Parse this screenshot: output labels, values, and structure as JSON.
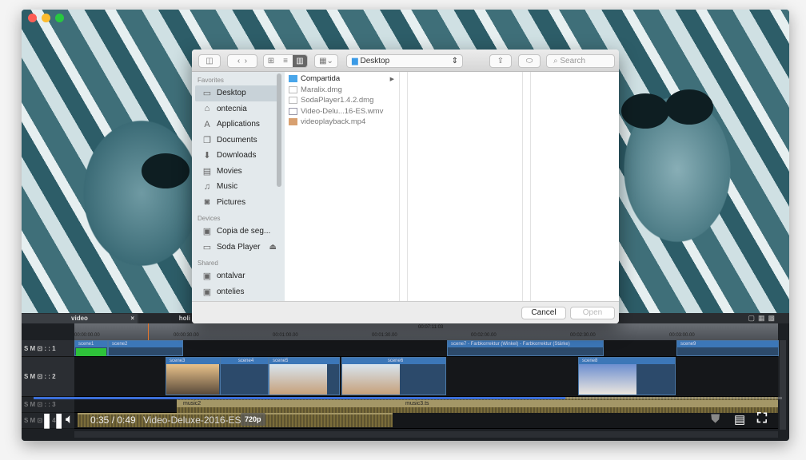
{
  "window": {
    "traffic_lights": {
      "close": "#fc5f57",
      "minimize": "#fdbc2e",
      "zoom": "#28c840"
    }
  },
  "timeline": {
    "tabs": [
      "video",
      "holi"
    ],
    "tab_close": "×",
    "ruler_center": "00:07:11:03",
    "ruler_labels": [
      "00:00:00.00",
      "00:00:30.00",
      "00:01:00.00",
      "00:01:30.00",
      "00:02:00.00",
      "00:02:30.00",
      "00:03:00.00"
    ],
    "tracks": [
      {
        "label": "S M ⊡ : : 1"
      },
      {
        "label": "S M ⊡ : : 2"
      },
      {
        "label": "S M ⊡ : : 3"
      },
      {
        "label": "S M ⊡ : : 4"
      }
    ],
    "clips": {
      "scene1": "scene1",
      "scene2": "scene2",
      "scene3": "scene3",
      "scene4": "scene4",
      "scene5": "scene5",
      "scene6": "scene6",
      "scene7": "scene7 - Farbkorrektur (Winkel) - Farbkorrektur (Stärke)",
      "scene8": "scene8",
      "scene9": "scene9",
      "music2": "music2",
      "music3": "music3.ts"
    }
  },
  "player": {
    "time": "0:35 / 0:49",
    "title": "Video-Deluxe-2016-ES",
    "quality": "720p",
    "progress_percent": 71,
    "accent": "#3c6fd8",
    "icons": [
      "pause-icon",
      "volume-icon",
      "shield-icon",
      "subtitles-icon",
      "fullscreen-icon"
    ]
  },
  "dialog": {
    "location": "Desktop",
    "search_placeholder": "Search",
    "sidebar": {
      "favorites_header": "Favorites",
      "favorites": [
        {
          "label": "Desktop",
          "icon": "desktop-icon"
        },
        {
          "label": "ontecnia",
          "icon": "home-icon"
        },
        {
          "label": "Applications",
          "icon": "applications-icon"
        },
        {
          "label": "Documents",
          "icon": "documents-icon"
        },
        {
          "label": "Downloads",
          "icon": "downloads-icon"
        },
        {
          "label": "Movies",
          "icon": "movies-icon"
        },
        {
          "label": "Music",
          "icon": "music-icon"
        },
        {
          "label": "Pictures",
          "icon": "pictures-icon"
        }
      ],
      "devices_header": "Devices",
      "devices": [
        {
          "label": "Copia de seg..."
        },
        {
          "label": "Soda Player"
        }
      ],
      "shared_header": "Shared",
      "shared": [
        {
          "label": "ontalvar"
        },
        {
          "label": "ontelies"
        }
      ]
    },
    "files": [
      {
        "name": "Compartida",
        "type": "folder"
      },
      {
        "name": "Maralix.dmg",
        "type": "dmg"
      },
      {
        "name": "SodaPlayer1.4.2.dmg",
        "type": "dmg"
      },
      {
        "name": "Video-Delu...16-ES.wmv",
        "type": "wmv"
      },
      {
        "name": "videoplayback.mp4",
        "type": "mp4"
      }
    ],
    "cancel": "Cancel",
    "open": "Open"
  }
}
